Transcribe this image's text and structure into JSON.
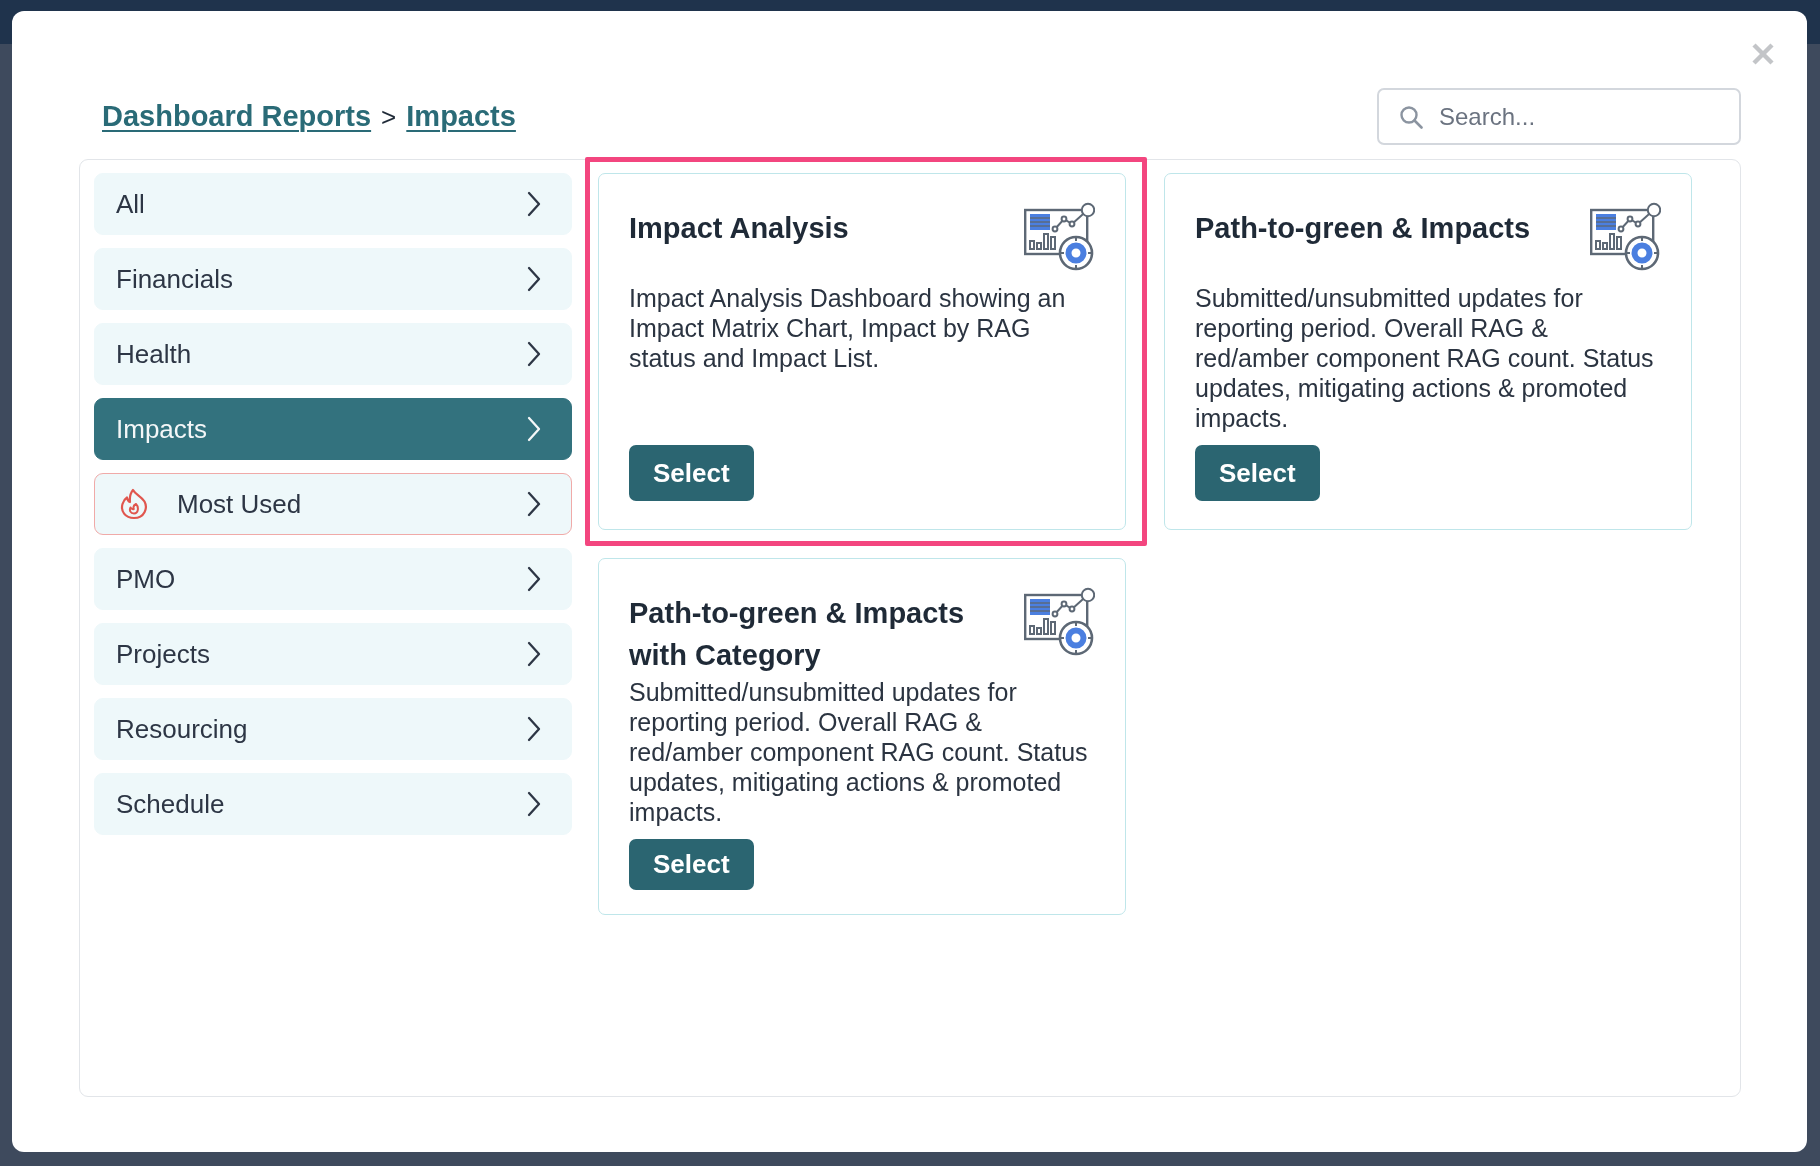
{
  "breadcrumb": {
    "items": [
      "Dashboard Reports",
      "Impacts"
    ],
    "separator": ">"
  },
  "search": {
    "placeholder": "Search..."
  },
  "categories": [
    {
      "label": "All",
      "kind": "category",
      "selected": false
    },
    {
      "label": "Financials",
      "kind": "category",
      "selected": false
    },
    {
      "label": "Health",
      "kind": "category",
      "selected": false
    },
    {
      "label": "Impacts",
      "kind": "category",
      "selected": true
    },
    {
      "label": "Most Used",
      "kind": "featured",
      "selected": false
    },
    {
      "label": "PMO",
      "kind": "category",
      "selected": false
    },
    {
      "label": "Projects",
      "kind": "category",
      "selected": false
    },
    {
      "label": "Resourcing",
      "kind": "category",
      "selected": false
    },
    {
      "label": "Schedule",
      "kind": "category",
      "selected": false
    }
  ],
  "reports": [
    {
      "title": "Impact Analysis",
      "description": "Impact Analysis Dashboard showing an Impact Matrix Chart, Impact by RAG status and Impact List.",
      "button": "Select",
      "highlighted": true
    },
    {
      "title": "Path-to-green & Impacts",
      "description": "Submitted/unsubmitted updates for reporting period. Overall RAG & red/amber component RAG count. Status updates, mitigating actions & promoted impacts.",
      "button": "Select",
      "highlighted": false
    },
    {
      "title": "Path-to-green & Impacts with Category",
      "description": "Submitted/unsubmitted updates for reporting period. Overall RAG & red/amber component RAG count. Status updates, mitigating actions & promoted impacts.",
      "button": "Select",
      "highlighted": false
    }
  ]
}
